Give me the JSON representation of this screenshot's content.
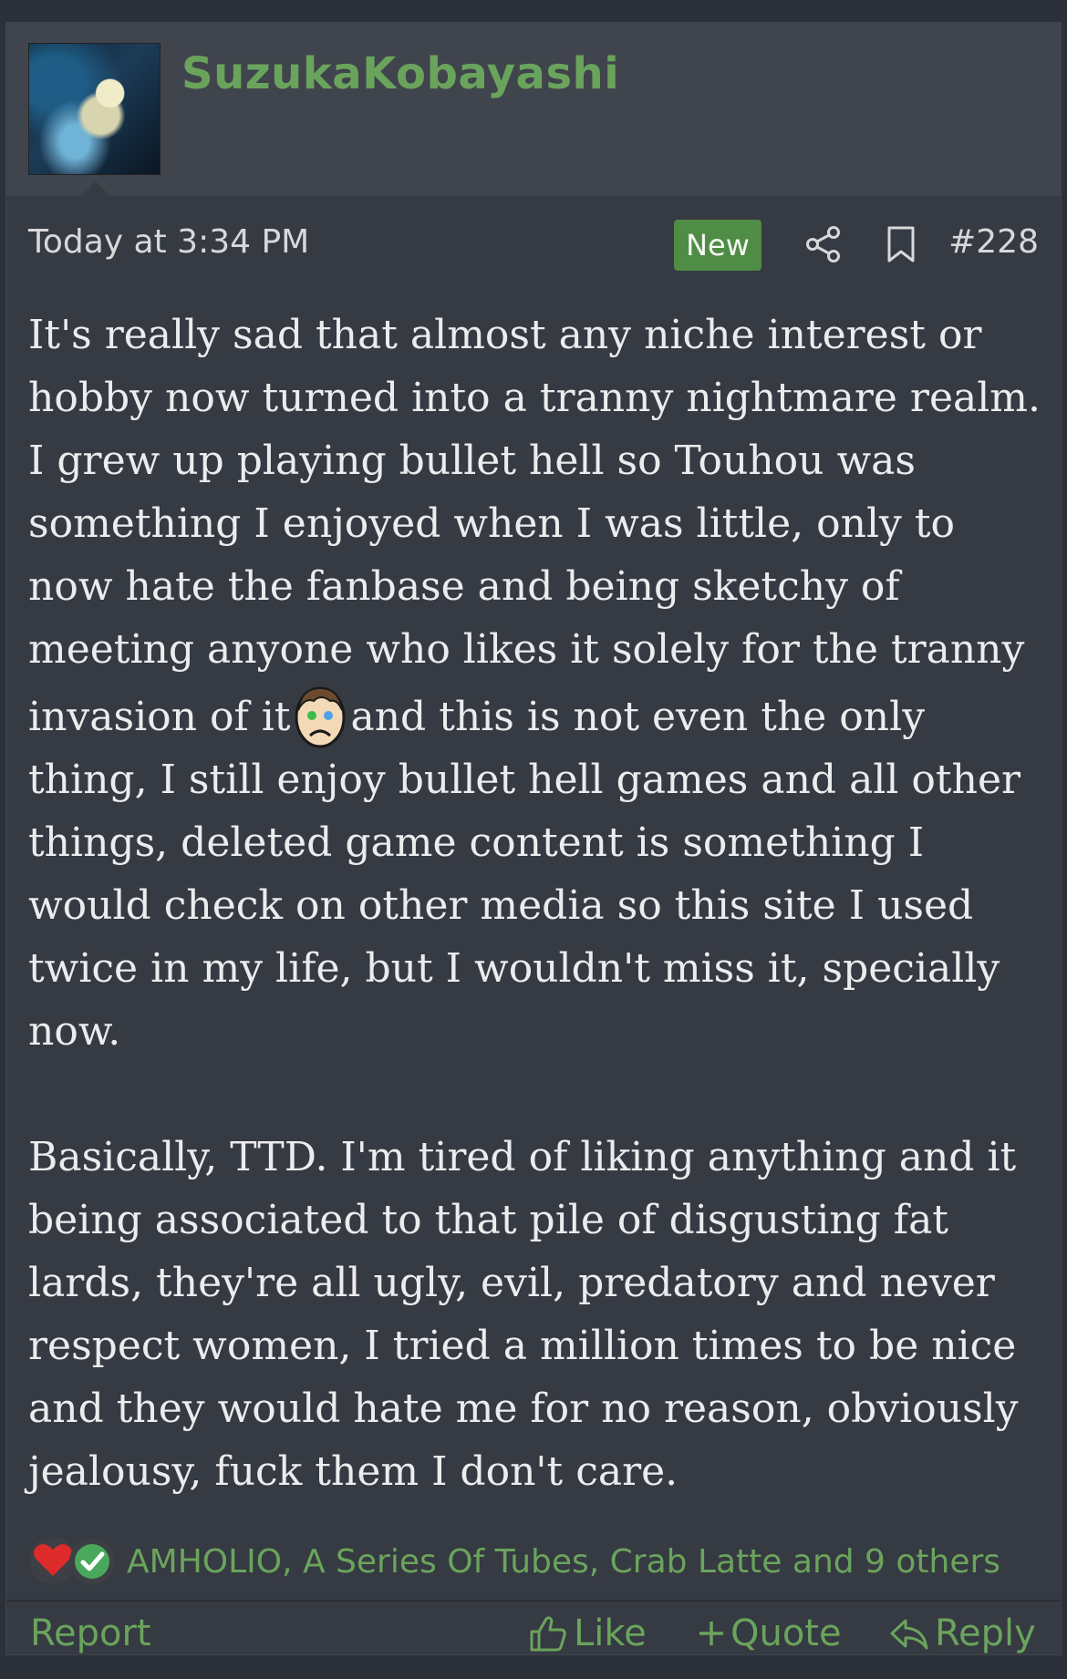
{
  "post": {
    "username": "SuzukaKobayashi",
    "timestamp": "Today at 3:34 PM",
    "badge": "New",
    "post_number": "#228",
    "paragraph1_before_emoji": "It's really sad that almost any niche interest or hobby now turned into a tranny nightmare realm. I grew up playing bullet hell so Touhou was something I enjoyed when I was little, only to now hate the fanbase and being sketchy of meeting anyone who likes it solely for the tranny invasion of it",
    "paragraph1_after_emoji": "and this is not even the only thing, I still enjoy bullet hell games and all other things, deleted game content is something I would check on other media so this site I used twice in my life, but I wouldn't miss it, specially now.",
    "paragraph2": "Basically, TTD. I'm tired of liking anything and it being associated to that pile of disgusting fat lards, they're all ugly, evil, predatory and never respect women, I tried a million times to be nice and they would hate me for no reason, obviously jealousy, fuck them I don't care.",
    "emoji_icon": "sad-face-emoji-icon",
    "reactions": {
      "icons": [
        "heart-icon",
        "check-icon"
      ],
      "text": "AMHOLIO, A Series Of Tubes, Crab Latte and 9 others"
    }
  },
  "actions": {
    "report": "Report",
    "like": "Like",
    "quote": "Quote",
    "reply": "Reply"
  },
  "colors": {
    "accent_green": "#6aa45c",
    "badge_green": "#4f8c45",
    "background": "#2c3038",
    "card": "#363a42",
    "header": "#40444d"
  }
}
